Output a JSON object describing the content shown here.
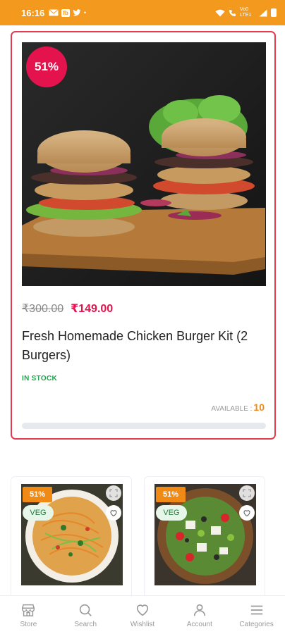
{
  "status_bar": {
    "time": "16:16",
    "left_icons": [
      "mail-badge-icon",
      "fb-badge-icon",
      "twitter-icon",
      "dot"
    ],
    "badge_fb": "fb",
    "badge_tw": "tw",
    "dot": "•",
    "network": "Vo0 LTE1",
    "color": "#f39a1e"
  },
  "feature": {
    "discount": "51%",
    "old_price": "₹300.00",
    "new_price": "₹149.00",
    "title": "Fresh Homemade Chicken Burger Kit (2 Burgers)",
    "stock": "IN STOCK",
    "available_label": "AVAILABLE :",
    "available_count": "10",
    "progress_fraction": 0.0,
    "border_color": "#e23b4e",
    "accent": "#e4134e"
  },
  "grid_items": [
    {
      "discount": "51%",
      "veg": "VEG",
      "image": "noodle-salad-bowl"
    },
    {
      "discount": "51%",
      "veg": "VEG",
      "image": "greek-salad-bowl"
    }
  ],
  "bottom_nav": [
    {
      "label": "Store",
      "icon": "store-icon"
    },
    {
      "label": "Search",
      "icon": "search-icon"
    },
    {
      "label": "Wishlist",
      "icon": "heart-icon"
    },
    {
      "label": "Account",
      "icon": "account-icon"
    },
    {
      "label": "Categories",
      "icon": "menu-icon"
    }
  ]
}
